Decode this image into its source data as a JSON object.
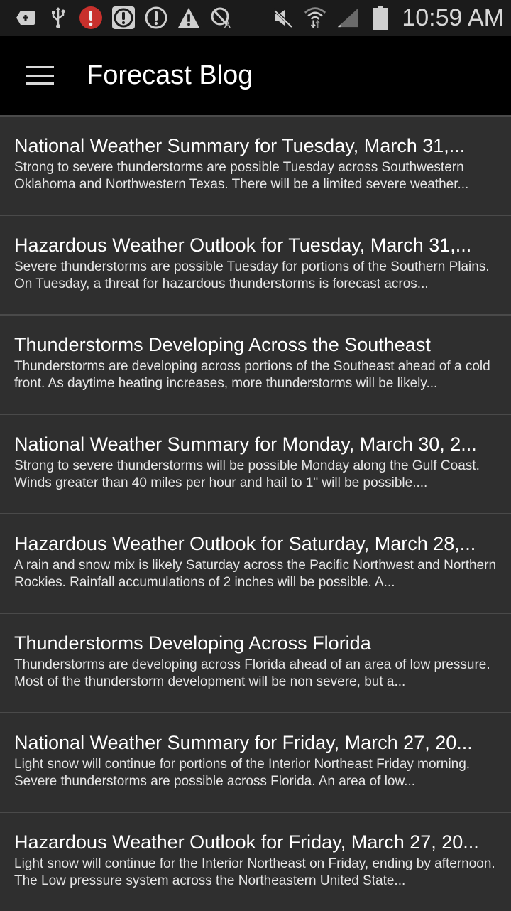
{
  "status_bar": {
    "time": "10:59 AM",
    "left_icons": [
      "add-notification-icon",
      "usb-icon",
      "alert-red-icon",
      "alert-square-icon",
      "alert-circle-icon",
      "warning-triangle-icon",
      "auto-rotate-off-icon"
    ],
    "right_icons": [
      "mute-icon",
      "wifi-icon",
      "signal-icon",
      "battery-icon"
    ],
    "colors": {
      "alert_red": "#c8302c"
    }
  },
  "app_bar": {
    "title": "Forecast Blog",
    "menu_icon": "hamburger-menu-icon"
  },
  "posts": [
    {
      "title": "National Weather Summary for Tuesday, March 31,...",
      "body": "Strong to severe thunderstorms are possible Tuesday across Southwestern Oklahoma and Northwestern Texas. There will be a limited severe weather..."
    },
    {
      "title": "Hazardous Weather Outlook for Tuesday, March 31,...",
      "body": "Severe thunderstorms are possible Tuesday for portions of the Southern Plains. On Tuesday, a threat for hazardous thunderstorms is forecast acros..."
    },
    {
      "title": "Thunderstorms Developing Across the Southeast",
      "body": "Thunderstorms are developing across portions of the Southeast ahead of a cold front. As daytime heating increases, more thunderstorms will be likely..."
    },
    {
      "title": "National Weather Summary for Monday, March 30, 2...",
      "body": "Strong to severe thunderstorms will be possible Monday along the Gulf Coast. Winds greater than 40 miles per hour and hail to 1\" will be possible...."
    },
    {
      "title": "Hazardous Weather Outlook for Saturday, March 28,...",
      "body": "A rain and snow mix is likely Saturday across the Pacific Northwest and Northern Rockies. Rainfall accumulations of 2 inches will be possible. A..."
    },
    {
      "title": "Thunderstorms Developing Across Florida",
      "body": "Thunderstorms are developing across Florida ahead of an area of low pressure. Most of the thunderstorm development will be non severe, but a..."
    },
    {
      "title": "National Weather Summary for Friday, March 27, 20...",
      "body": "Light snow will continue for portions of the Interior Northeast Friday morning. Severe thunderstorms are possible across Florida. An area of low..."
    },
    {
      "title": "Hazardous Weather Outlook for Friday, March 27, 20...",
      "body": "Light snow will continue for the Interior Northeast on Friday, ending by afternoon. The Low pressure system across the Northeastern United State..."
    }
  ]
}
